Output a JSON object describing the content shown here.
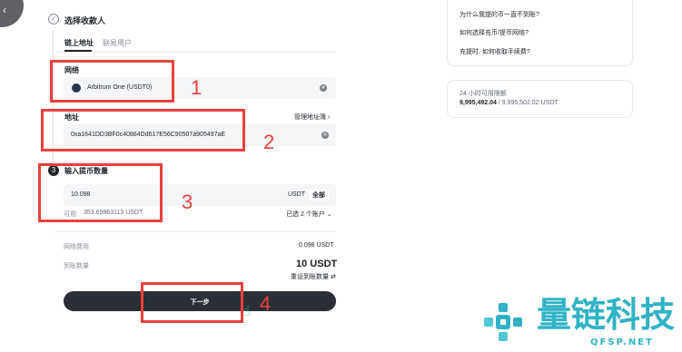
{
  "form": {
    "section_title": "选择收款人",
    "tabs": [
      "链上地址",
      "联易用户"
    ],
    "network_label": "网络",
    "network_value": "Arbitrum One (USDT0)",
    "address_label": "地址",
    "address_manage": "管理地址簿",
    "address_value": "0xa1641DD3BF0c40884Dd617E56C90507a905497aE",
    "step_number": "3",
    "amount_title": "输入提币数量",
    "amount_value": "10.098",
    "amount_unit": "USDT",
    "amount_all": "全部",
    "available_label": "可用:",
    "available_value": "353.69863113 USDT",
    "accounts_selected": "已选 2 个账户",
    "fee_label": "网络费用",
    "fee_value": "0.098 USDT",
    "receive_label": "到账数量",
    "receive_value": "10 USDT",
    "reset_label": "重设到账数量",
    "next_button": "下一步"
  },
  "sidebar": {
    "faq": [
      "为什么我提的币一直不到账?",
      "如何选择充币/提币网络?",
      "充提时, 如何收取手续费?"
    ],
    "limit_title": "24 小时可用限额",
    "limit_used": "9,995,492.04",
    "limit_total": "/ 9,995,502.02 USDT"
  },
  "annotations": [
    "1",
    "2",
    "3",
    "4"
  ],
  "watermark": {
    "name": "量链科技",
    "domain": "QFSP.NET"
  },
  "colors": {
    "annotation": "#e8413c",
    "brand": "#2fb3c4",
    "button": "#2b2f36"
  }
}
